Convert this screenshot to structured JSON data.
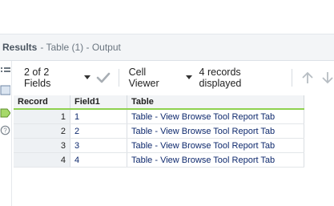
{
  "results": {
    "title": "Results",
    "subtitle": "- Table (1) - Output"
  },
  "toolbar": {
    "fields_label": "2 of 2 Fields",
    "cell_viewer_label": "Cell Viewer",
    "records_status": "4 records displayed"
  },
  "icons": {
    "fields_dropdown": "chevron-down-icon",
    "apply": "checkmark-icon",
    "cell_viewer_dropdown": "chevron-down-icon",
    "scroll_up": "arrow-up-icon",
    "scroll_down": "arrow-down-icon",
    "strip": [
      "list-icon",
      "table-view-icon",
      "tag-icon",
      "help-icon"
    ]
  },
  "colors": {
    "accent_green": "#8fd14f",
    "link_text": "#0f2a6e",
    "header_bg": "#f3f5f7"
  },
  "table": {
    "columns": [
      "Record",
      "Field1",
      "Table"
    ],
    "rows": [
      {
        "record": "1",
        "field1": "1",
        "table": "Table - View Browse Tool Report Tab"
      },
      {
        "record": "2",
        "field1": "2",
        "table": "Table - View Browse Tool Report Tab"
      },
      {
        "record": "3",
        "field1": "3",
        "table": "Table - View Browse Tool Report Tab"
      },
      {
        "record": "4",
        "field1": "4",
        "table": "Table - View Browse Tool Report Tab"
      }
    ]
  }
}
